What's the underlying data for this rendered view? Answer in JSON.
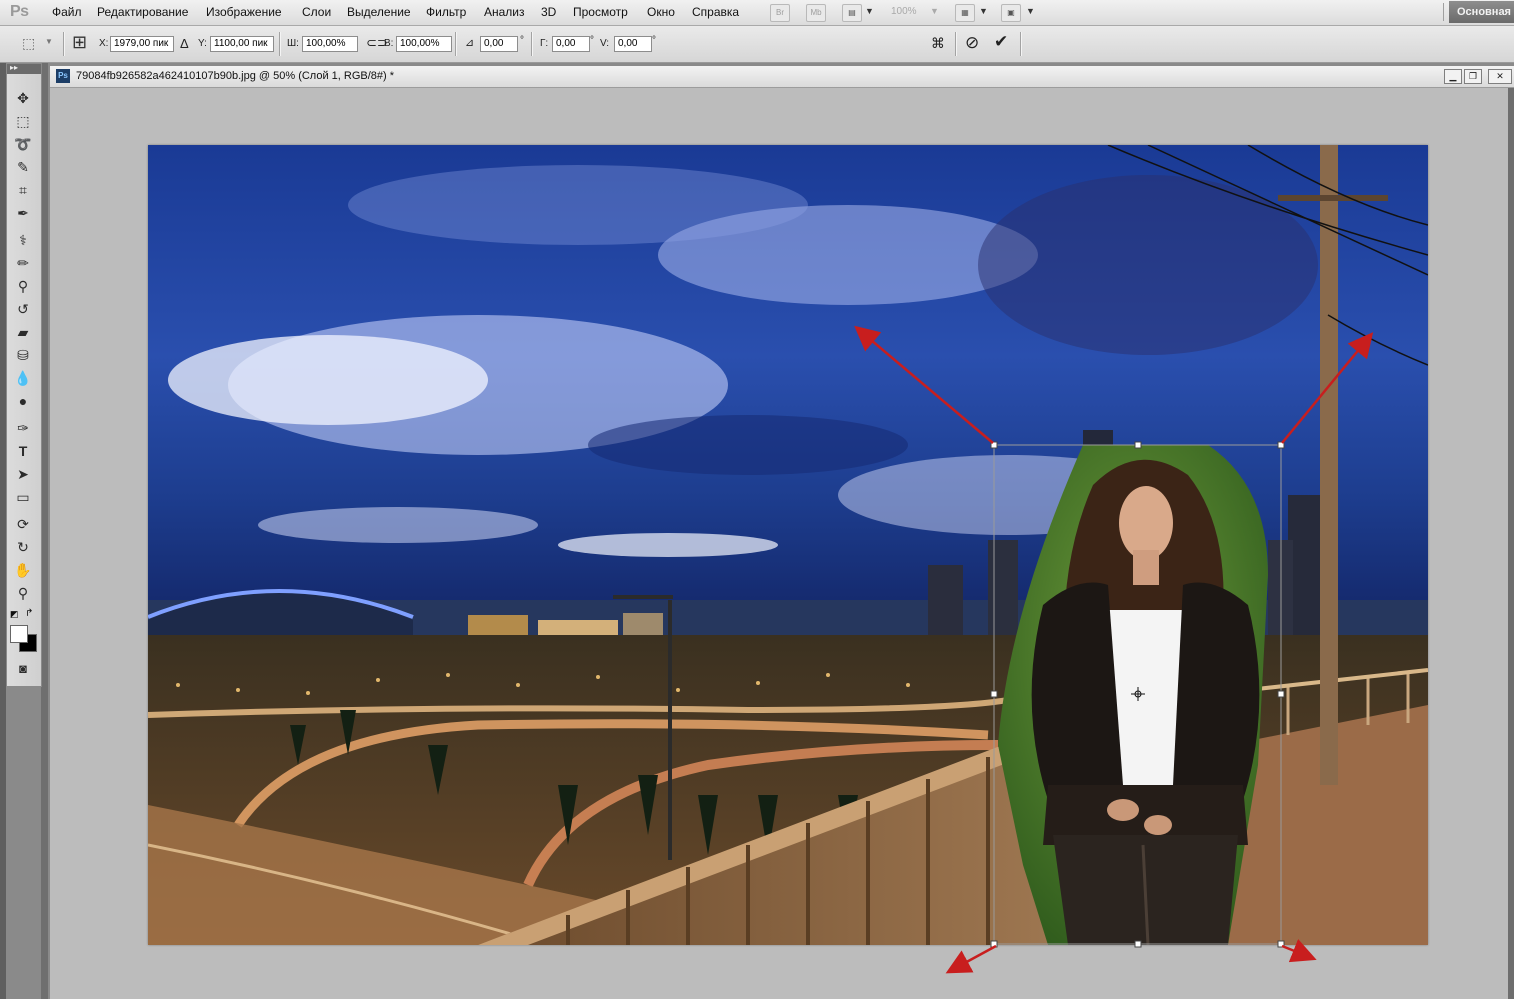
{
  "app": {
    "logo": "Ps"
  },
  "menu": [
    "Файл",
    "Редактирование",
    "Изображение",
    "Слои",
    "Выделение",
    "Фильтр",
    "Анализ",
    "3D",
    "Просмотр",
    "Окно",
    "Справка"
  ],
  "menubar": {
    "bridge_label": "Br",
    "minibridge_label": "Mb",
    "zoom_level": "100%",
    "workspace": "Основная"
  },
  "options": {
    "x_label": "X:",
    "x_value": "1979,00 пик",
    "delta_symbol": "Δ",
    "y_label": "Y:",
    "y_value": "1100,00 пик",
    "w_label": "Ш:",
    "w_value": "100,00%",
    "h_label": "В:",
    "h_value": "100,00%",
    "angle_value": "0,00",
    "angle_unit": "°",
    "h_skew_label": "Г:",
    "h_skew_value": "0,00",
    "h_skew_unit": "°",
    "v_skew_label": "V:",
    "v_skew_value": "0,00",
    "v_skew_unit": "°"
  },
  "document": {
    "icon_label": "Ps",
    "title": "79084fb926582a462410107b90b.jpg @ 50% (Слой 1, RGB/8#) *"
  },
  "colors": {
    "accent": "#c81e1e",
    "workspace_button": "#7c7c7c",
    "canvas_background": "#bcbcbc"
  },
  "icons": [
    "move-icon",
    "marquee-icon",
    "lasso-icon",
    "quick-select-icon",
    "crop-icon",
    "eyedropper-icon",
    "healing-brush-icon",
    "brush-icon",
    "clone-stamp-icon",
    "history-brush-icon",
    "eraser-icon",
    "paint-bucket-icon",
    "blur-icon",
    "dodge-icon",
    "pen-icon",
    "type-icon",
    "path-select-icon",
    "shape-icon",
    "3d-rotate-icon",
    "3d-orbit-icon",
    "hand-icon",
    "zoom-icon"
  ]
}
